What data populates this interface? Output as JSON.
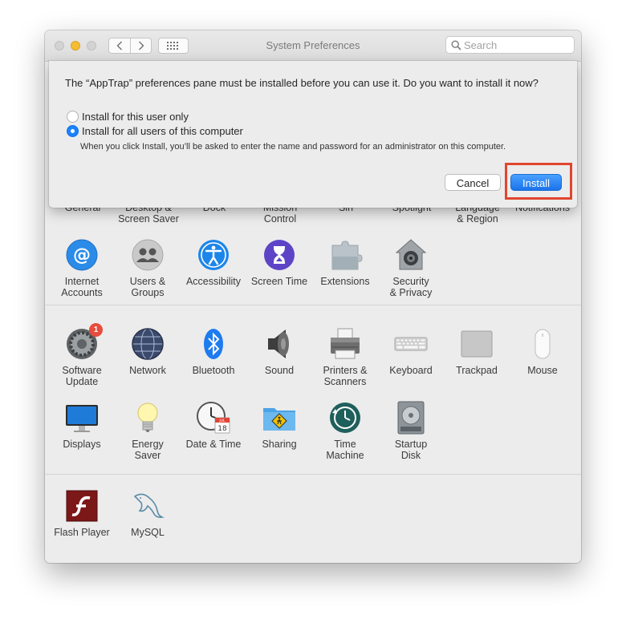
{
  "window": {
    "title": "System Preferences"
  },
  "search": {
    "placeholder": "Search"
  },
  "sheet": {
    "message": "The “AppTrap” preferences pane must be installed before you can use it. Do you want to install it now?",
    "option_user": "Install for this user only",
    "option_all": "Install for all users of this computer",
    "selected_option": "option_all",
    "note": "When you click Install, you’ll be asked to enter the name and password for an administrator on this computer.",
    "cancel_label": "Cancel",
    "install_label": "Install"
  },
  "row1_partial": [
    {
      "line1": "General",
      "line2": ""
    },
    {
      "line1": "Desktop &",
      "line2": "Screen Saver"
    },
    {
      "line1": "Dock",
      "line2": ""
    },
    {
      "line1": "Mission",
      "line2": "Control"
    },
    {
      "line1": "Siri",
      "line2": ""
    },
    {
      "line1": "Spotlight",
      "line2": ""
    },
    {
      "line1": "Language",
      "line2": "& Region"
    },
    {
      "line1": "Notifications",
      "line2": ""
    }
  ],
  "row2": [
    {
      "line1": "Internet",
      "line2": "Accounts",
      "icon": "at-icon"
    },
    {
      "line1": "Users &",
      "line2": "Groups",
      "icon": "users-icon"
    },
    {
      "line1": "Accessibility",
      "line2": "",
      "icon": "accessibility-icon"
    },
    {
      "line1": "Screen Time",
      "line2": "",
      "icon": "hourglass-icon"
    },
    {
      "line1": "Extensions",
      "line2": "",
      "icon": "puzzle-icon"
    },
    {
      "line1": "Security",
      "line2": "& Privacy",
      "icon": "house-lock-icon"
    }
  ],
  "row3": [
    {
      "line1": "Software",
      "line2": "Update",
      "icon": "gear-icon",
      "badge": "1"
    },
    {
      "line1": "Network",
      "line2": "",
      "icon": "globe-icon"
    },
    {
      "line1": "Bluetooth",
      "line2": "",
      "icon": "bluetooth-icon"
    },
    {
      "line1": "Sound",
      "line2": "",
      "icon": "speaker-icon"
    },
    {
      "line1": "Printers &",
      "line2": "Scanners",
      "icon": "printer-icon"
    },
    {
      "line1": "Keyboard",
      "line2": "",
      "icon": "keyboard-icon"
    },
    {
      "line1": "Trackpad",
      "line2": "",
      "icon": "trackpad-icon"
    },
    {
      "line1": "Mouse",
      "line2": "",
      "icon": "mouse-icon"
    }
  ],
  "row4": [
    {
      "line1": "Displays",
      "line2": "",
      "icon": "display-icon"
    },
    {
      "line1": "Energy",
      "line2": "Saver",
      "icon": "lightbulb-icon"
    },
    {
      "line1": "Date & Time",
      "line2": "",
      "icon": "clock-calendar-icon",
      "calendar_month": "JUL",
      "calendar_day": "18"
    },
    {
      "line1": "Sharing",
      "line2": "",
      "icon": "sharing-folder-icon"
    },
    {
      "line1": "Time",
      "line2": "Machine",
      "icon": "time-machine-icon"
    },
    {
      "line1": "Startup",
      "line2": "Disk",
      "icon": "hard-disk-icon"
    }
  ],
  "row5": [
    {
      "line1": "Flash Player",
      "line2": "",
      "icon": "flash-icon"
    },
    {
      "line1": "MySQL",
      "line2": "",
      "icon": "dolphin-icon"
    }
  ]
}
